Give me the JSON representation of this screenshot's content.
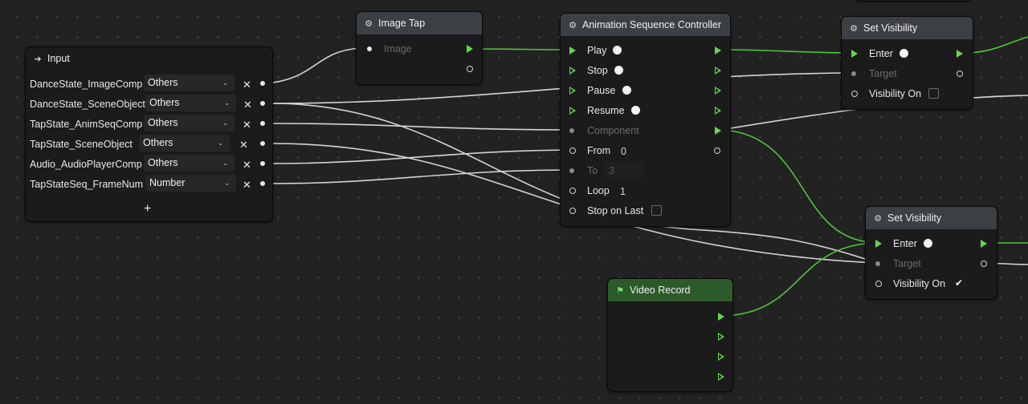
{
  "input_node": {
    "title": "Input",
    "title_icon": "enter-arrow-icon",
    "rows": [
      {
        "name": "DanceState_ImageComp",
        "type": "Others"
      },
      {
        "name": "DanceState_SceneObject",
        "type": "Others"
      },
      {
        "name": "TapState_AnimSeqComp",
        "type": "Others"
      },
      {
        "name": "TapState_SceneObject",
        "type": "Others"
      },
      {
        "name": "Audio_AudioPlayerComp",
        "type": "Others"
      },
      {
        "name": "TapStateSeq_FrameNum",
        "type": "Number"
      }
    ],
    "remove_symbol": "✕",
    "add_symbol": "+"
  },
  "image_tap": {
    "title": "Image Tap",
    "title_icon": "gear-icon",
    "image_label": "Image"
  },
  "anim_seq": {
    "title": "Animation Sequence Controller",
    "title_icon": "gear-icon",
    "play": "Play",
    "stop": "Stop",
    "pause": "Pause",
    "resume": "Resume",
    "component": "Component",
    "from_label": "From",
    "from_value": "0",
    "to_label": "To",
    "to_value": "3",
    "loop_label": "Loop",
    "loop_value": "1",
    "stop_on_last": "Stop on Last"
  },
  "set_vis_1": {
    "title": "Set Visibility",
    "title_icon": "gear-icon",
    "enter": "Enter",
    "target": "Target",
    "visibility_on": "Visibility On",
    "checked": false
  },
  "set_vis_2": {
    "title": "Set Visibility",
    "title_icon": "gear-icon",
    "enter": "Enter",
    "target": "Target",
    "visibility_on": "Visibility On",
    "checked": true,
    "check_symbol": "✔"
  },
  "video_record": {
    "title": "Video Record",
    "title_icon": "flag-icon"
  },
  "colors": {
    "background": "#222222",
    "node_body": "#1b1b1b",
    "node_header": "#3c3f44",
    "video_header": "#2d5a2a",
    "exec_wire": "#52c43f",
    "data_wire": "#d4d4d4"
  }
}
